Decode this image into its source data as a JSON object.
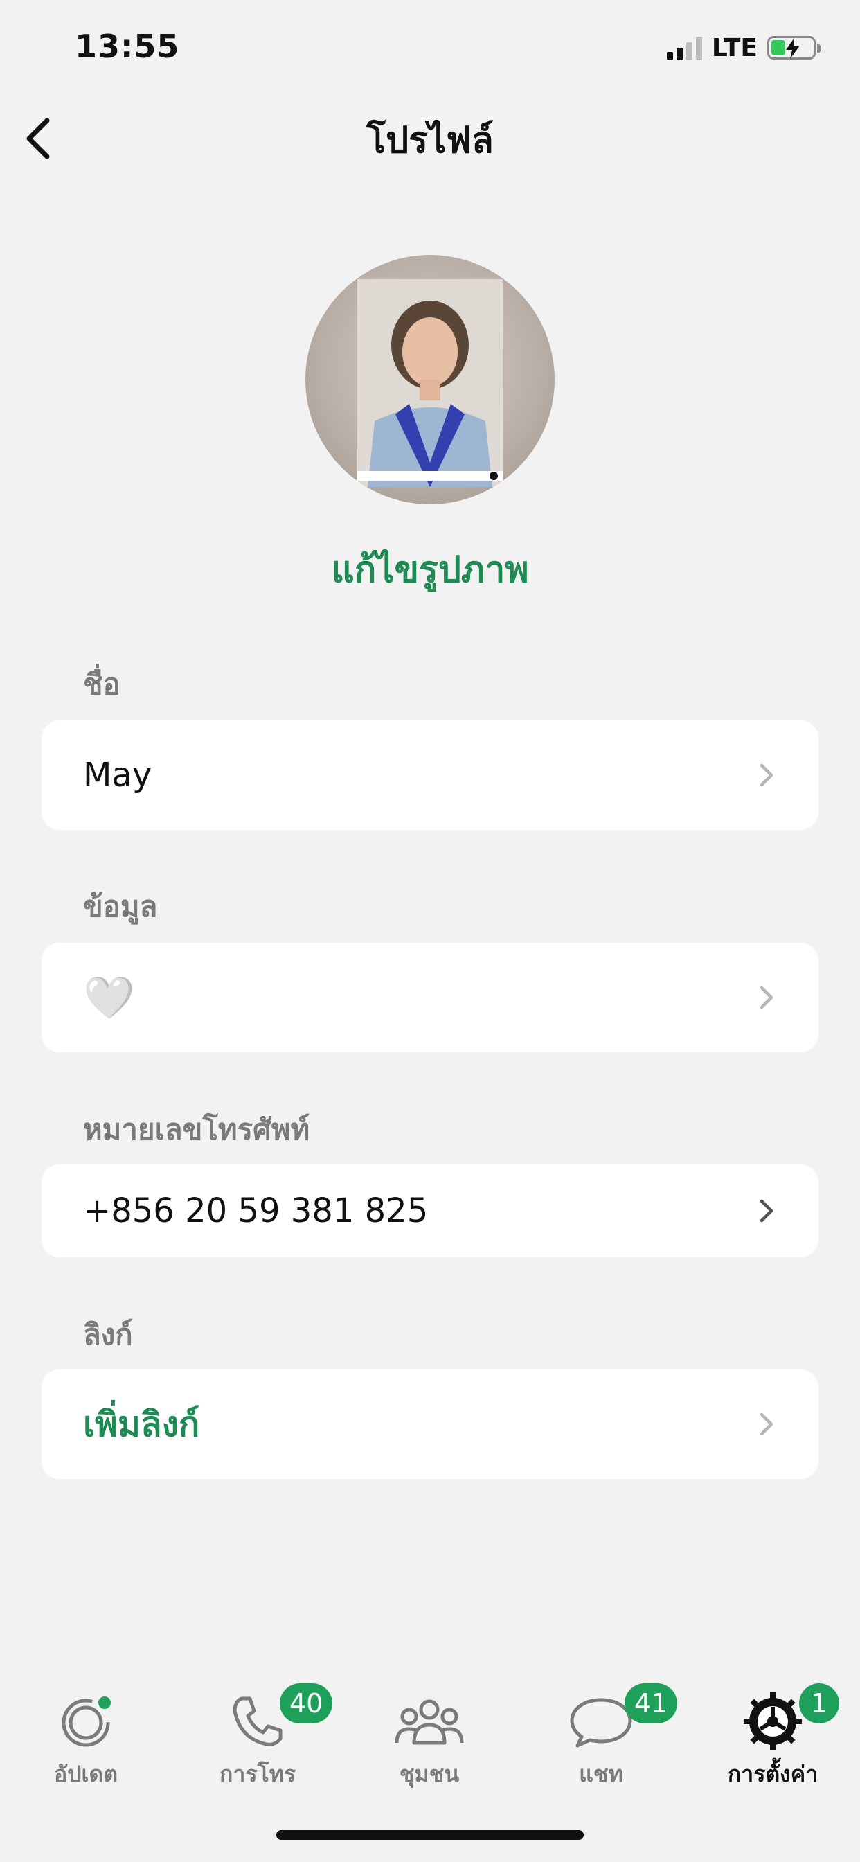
{
  "status_bar": {
    "time": "13:55",
    "network": "LTE",
    "signal_bars": 2,
    "battery_charging": true
  },
  "nav": {
    "title": "โปรไฟล์",
    "back_icon": "chevron-left-icon"
  },
  "profile": {
    "edit_photo_label": "แก้ไขรูปภาพ"
  },
  "sections": [
    {
      "label": "ชื่อ",
      "value": "May",
      "icon": "chevron-right-icon"
    },
    {
      "label": "ข้อมูล",
      "value": "🤍",
      "icon": "chevron-right-icon"
    },
    {
      "label": "หมายเลขโทรศัพท์",
      "value": "+856 20 59 381 825",
      "icon": "chevron-right-icon"
    },
    {
      "label": "ลิงก์",
      "value": "เพิ่มลิงก์",
      "icon": "chevron-right-icon"
    }
  ],
  "tabbar": {
    "tabs": [
      {
        "label": "อัปเดต",
        "icon": "updates-icon",
        "badge": ""
      },
      {
        "label": "การโทร",
        "icon": "phone-icon",
        "badge": "40"
      },
      {
        "label": "ชุมชน",
        "icon": "community-icon",
        "badge": ""
      },
      {
        "label": "แชท",
        "icon": "chat-icon",
        "badge": "41"
      },
      {
        "label": "การตั้งค่า",
        "icon": "settings-icon",
        "badge": "1",
        "active": true
      }
    ]
  },
  "colors": {
    "accent": "#1f8a54",
    "badge": "#1ea05a",
    "background": "#f2f2f2"
  }
}
